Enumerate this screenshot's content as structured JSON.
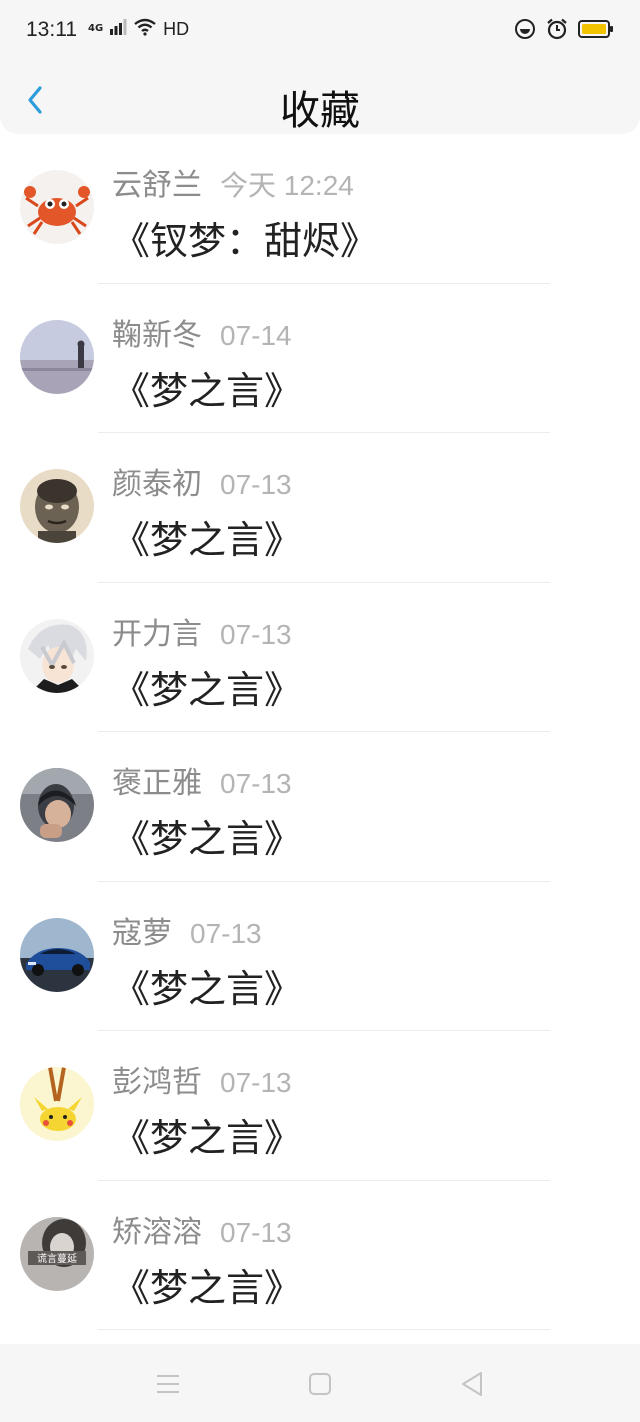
{
  "status_bar": {
    "time": "13:11",
    "network": "4G",
    "hd": "HD"
  },
  "header": {
    "title": "收藏"
  },
  "favorites": [
    {
      "name": "云舒兰",
      "time": "今天 12:24",
      "title": "《钗梦：甜烬》",
      "avatar": "crab"
    },
    {
      "name": "鞠新冬",
      "time": "07-14",
      "title": "《梦之言》",
      "avatar": "seaside"
    },
    {
      "name": "颜泰初",
      "time": "07-13",
      "title": "《梦之言》",
      "avatar": "man-sketch"
    },
    {
      "name": "开力言",
      "time": "07-13",
      "title": "《梦之言》",
      "avatar": "anime-boy"
    },
    {
      "name": "褒正雅",
      "time": "07-13",
      "title": "《梦之言》",
      "avatar": "young-man"
    },
    {
      "name": "寇萝",
      "time": "07-13",
      "title": "《梦之言》",
      "avatar": "blue-car"
    },
    {
      "name": "彭鸿哲",
      "time": "07-13",
      "title": "《梦之言》",
      "avatar": "pikachu"
    },
    {
      "name": "矫溶溶",
      "time": "07-13",
      "title": "《梦之言》",
      "avatar": "girl-bw",
      "avatar_text": "谎言蔓延"
    }
  ],
  "colors": {
    "accent": "#2d9cdb",
    "name_text": "#8c8c8c",
    "time_text": "#b4b4b4",
    "bar_bg": "#f6f6f6"
  },
  "icons": [
    "back-arrow-icon",
    "signal-icon",
    "wifi-icon",
    "do-not-disturb-icon",
    "alarm-icon",
    "battery-icon",
    "menu-icon",
    "home-icon",
    "back-triangle-icon"
  ]
}
